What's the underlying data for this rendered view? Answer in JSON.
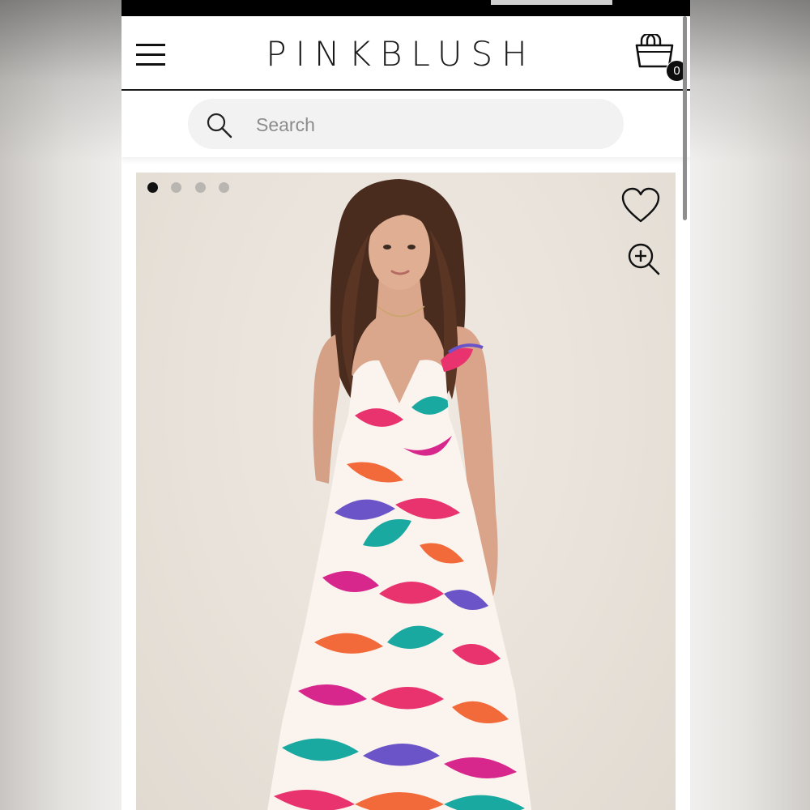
{
  "header": {
    "logo_text": "PINKBLUSH",
    "cart_count": "0"
  },
  "search": {
    "placeholder": "Search",
    "value": ""
  },
  "gallery": {
    "dot_count": 4,
    "active_index": 0
  },
  "icons": {
    "menu": "hamburger-menu-icon",
    "cart": "shopping-bag-icon",
    "search": "magnifier-icon",
    "wishlist": "heart-outline-icon",
    "zoom": "zoom-in-icon"
  },
  "colors": {
    "dress_pink": "#e8336f",
    "dress_magenta": "#d8278c",
    "dress_orange": "#f26a3a",
    "dress_teal": "#1aa9a0",
    "dress_purple": "#6b53c8",
    "dot_active": "#111111",
    "dot_inactive": "#b9b6b2"
  }
}
